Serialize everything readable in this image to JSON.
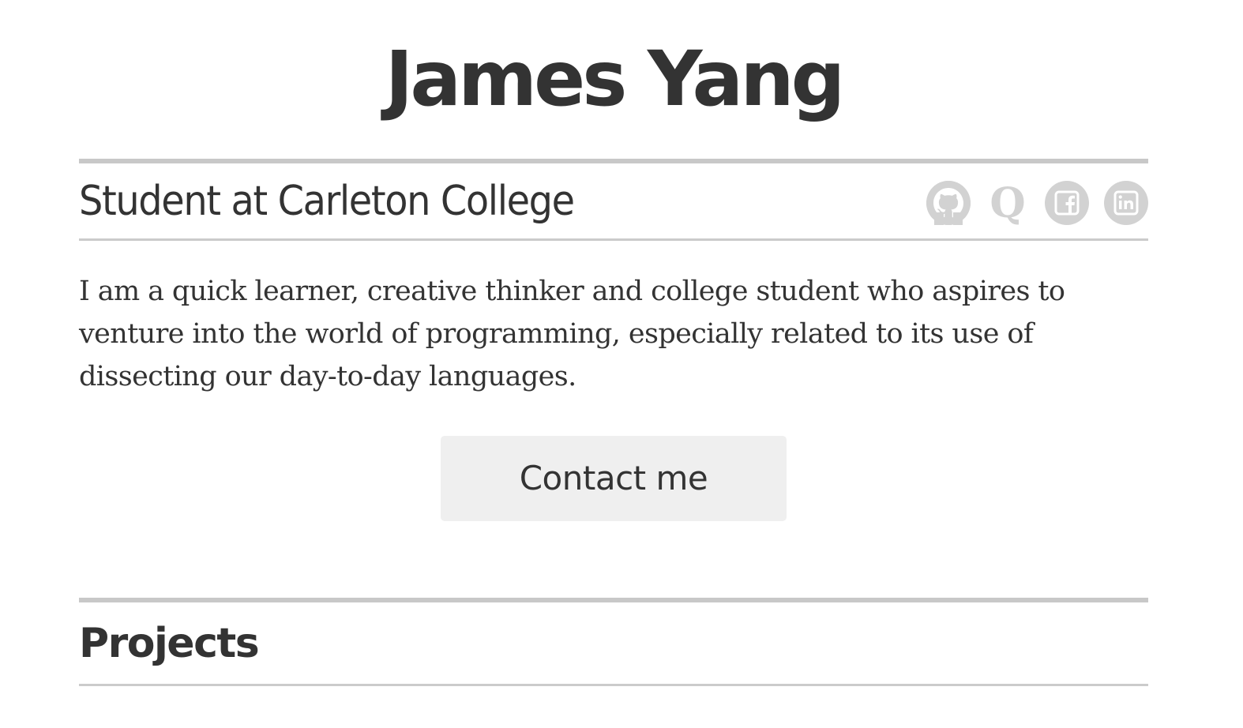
{
  "header": {
    "name": "James Yang"
  },
  "subtitle": {
    "text": "Student at Carleton College"
  },
  "social_links": [
    {
      "icon": "github-icon",
      "label": "GitHub"
    },
    {
      "icon": "quora-icon",
      "label": "Quora"
    },
    {
      "icon": "facebook-icon",
      "label": "Facebook"
    },
    {
      "icon": "linkedin-icon",
      "label": "LinkedIn"
    }
  ],
  "bio": {
    "text": "I am a quick learner, creative thinker and college student who aspires to venture into the world of programming, especially related to its use of dissecting our day-to-day languages."
  },
  "contact": {
    "label": "Contact me"
  },
  "projects": {
    "heading": "Projects"
  },
  "colors": {
    "text": "#333333",
    "rule": "#c8c8c8",
    "icon": "#d2d2d2",
    "button_bg": "#efefef"
  }
}
